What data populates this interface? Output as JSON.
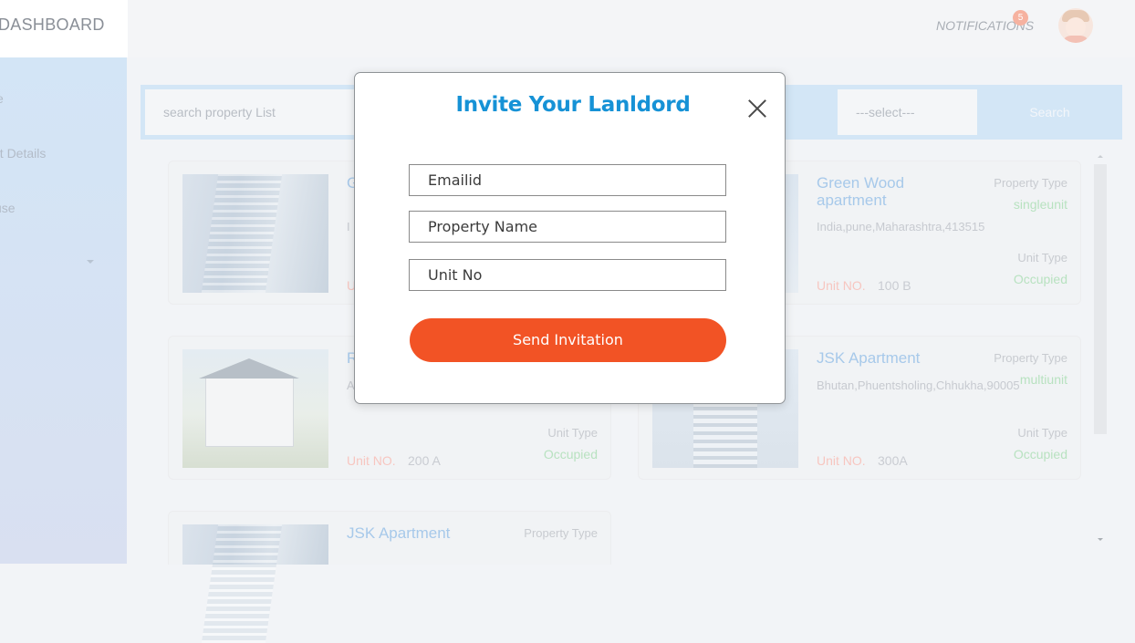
{
  "header": {
    "brand": "DASHBOARD",
    "notifications_label": "NOTIFICATIONS",
    "notifications_count": "5"
  },
  "sidebar": {
    "items": [
      {
        "label": "e"
      },
      {
        "label": "nt Details"
      },
      {
        "label": "use"
      }
    ]
  },
  "search": {
    "placeholder": "search property List",
    "select_value": "---select---",
    "button_label": "Search"
  },
  "cards": [
    {
      "name": "G\na",
      "address": "I",
      "property_type_label": "",
      "property_type": "",
      "unit_type_label": "",
      "unit_type": "",
      "unit_label": "U",
      "unit_no": ""
    },
    {
      "name": "Green Wood apartment",
      "address": "India,pune,Maharashtra,413515",
      "property_type_label": "Property Type",
      "property_type": "singleunit",
      "unit_type_label": "Unit Type",
      "unit_type": "Occupied",
      "unit_label": "Unit NO.",
      "unit_no": "100 B"
    },
    {
      "name": "R",
      "address": "A",
      "property_type_label": "",
      "property_type": "",
      "unit_type_label": "Unit Type",
      "unit_type": "Occupied",
      "unit_label": "Unit NO.",
      "unit_no": "200 A"
    },
    {
      "name": "JSK Apartment",
      "address": "Bhutan,Phuentsholing,Chhukha,90005",
      "property_type_label": "Property Type",
      "property_type": "multiunit",
      "unit_type_label": "Unit Type",
      "unit_type": "Occupied",
      "unit_label": "Unit NO.",
      "unit_no": "300A"
    },
    {
      "name": "JSK Apartment",
      "address": "",
      "property_type_label": "Property Type",
      "property_type": "",
      "unit_type_label": "",
      "unit_type": "",
      "unit_label": "",
      "unit_no": ""
    }
  ],
  "modal": {
    "title": "Invite Your Lanldord",
    "email_placeholder": "Emailid",
    "property_name_placeholder": "Property Name",
    "unit_no_placeholder": "Unit No",
    "send_button": "Send Invitation"
  },
  "colors": {
    "accent": "#1692d6",
    "primary_button": "#f25325"
  }
}
